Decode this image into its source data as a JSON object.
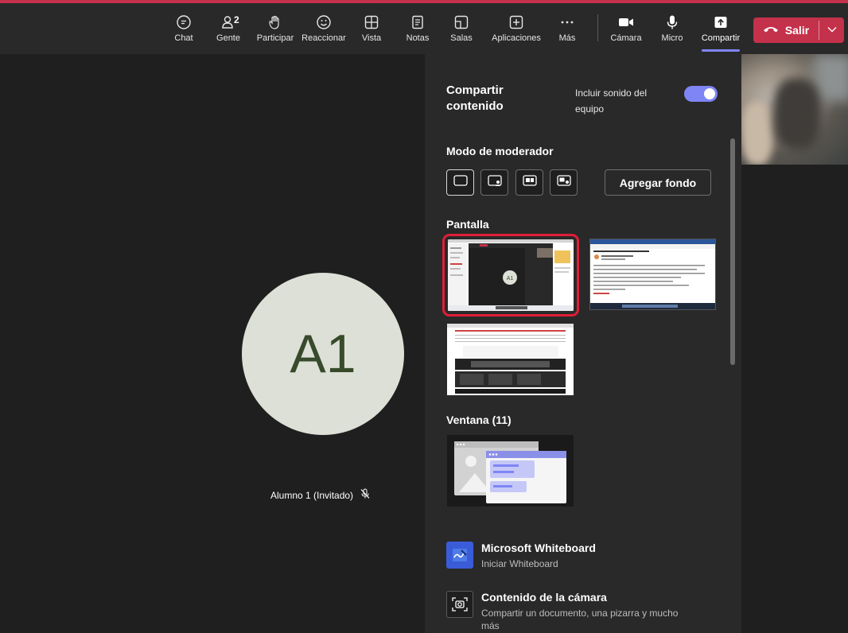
{
  "toolbar": {
    "items": [
      {
        "label": "Chat",
        "icon": "chat-icon"
      },
      {
        "label": "Gente",
        "icon": "people-icon",
        "count": "2"
      },
      {
        "label": "Participar",
        "icon": "raise-hand-icon"
      },
      {
        "label": "Reaccionar",
        "icon": "smile-icon"
      },
      {
        "label": "Vista",
        "icon": "grid-icon"
      },
      {
        "label": "Notas",
        "icon": "notes-icon"
      },
      {
        "label": "Salas",
        "icon": "rooms-icon"
      },
      {
        "label": "Aplicaciones",
        "icon": "plus-square-icon"
      },
      {
        "label": "Más",
        "icon": "more-icon"
      },
      {
        "label": "Cámara",
        "icon": "camera-icon"
      },
      {
        "label": "Micro",
        "icon": "mic-icon"
      },
      {
        "label": "Compartir",
        "icon": "share-icon",
        "active": true
      }
    ],
    "leave_label": "Salir"
  },
  "stage": {
    "avatar_initials": "A1",
    "participant_name": "Alumno 1 (Invitado)"
  },
  "panel": {
    "title": "Compartir contenido",
    "sound_label": "Incluir sonido del equipo",
    "sound_on": true,
    "presenter_mode_heading": "Modo de moderador",
    "add_background_label": "Agregar fondo",
    "screen_heading": "Pantalla",
    "window_heading": "Ventana (11)",
    "options": [
      {
        "title": "Microsoft Whiteboard",
        "subtitle": "Iniciar Whiteboard",
        "icon": "whiteboard-icon"
      },
      {
        "title": "Contenido de la cámara",
        "subtitle": "Compartir un documento, una pizarra y mucho más",
        "icon": "camera-content-icon"
      }
    ]
  },
  "colors": {
    "accent": "#7f85f5",
    "leave": "#c4314b",
    "selection": "#e01e37"
  }
}
